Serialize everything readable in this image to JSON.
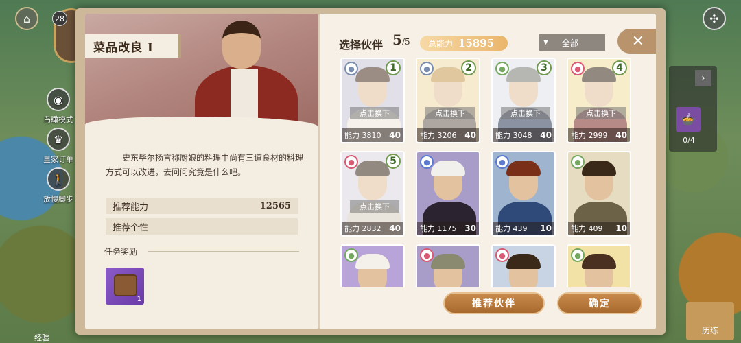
{
  "hud": {
    "level": "28",
    "buttons": [
      {
        "label": "鸟瞰模式"
      },
      {
        "label": "皇家订单"
      },
      {
        "label": "放慢脚步"
      }
    ],
    "exp_label": "经验",
    "side_count": "0/4",
    "bottom_label": "历练"
  },
  "quest": {
    "title": "菜品改良 I",
    "description": "史东毕尔扬言称厨娘的料理中尚有三道食材的料理方式可以改进，去问问究竟是什么吧。",
    "rec_power_label": "推荐能力",
    "rec_power_value": "12565",
    "rec_trait_label": "推荐个性",
    "reward_title": "任务奖励",
    "reward_qty": "1"
  },
  "partners": {
    "title": "选择伙伴",
    "selected": "5",
    "max": "/5",
    "total_label": "总能力",
    "total_value": "15895",
    "filter_label": "全部",
    "swap_label": "点击换下",
    "cards": [
      {
        "slot": "1",
        "power": "能力 3810",
        "level": "40",
        "selected": true,
        "bg": "#c8c6d8",
        "hair": "#4a3020",
        "body": "#efe6da",
        "badge": "#7a8fb0"
      },
      {
        "slot": "2",
        "power": "能力 3206",
        "level": "40",
        "selected": true,
        "bg": "#eed9a8",
        "hair": "#c79a4e",
        "body": "#6a5e54",
        "badge": "#7a8fb0"
      },
      {
        "slot": "3",
        "power": "能力 3048",
        "level": "40",
        "selected": true,
        "bg": "#dfe2e8",
        "hair": "#7a7a76",
        "body": "#2c3a55",
        "badge": "#74a860"
      },
      {
        "slot": "4",
        "power": "能力 2999",
        "level": "40",
        "selected": true,
        "bg": "#f0dfa0",
        "hair": "#3a2818",
        "body": "#7a2a26",
        "badge": "#d85a74"
      },
      {
        "slot": "5",
        "power": "能力 2832",
        "level": "40",
        "selected": true,
        "bg": "#dcd8e0",
        "hair": "#3a2818",
        "body": "#d9cfc0",
        "badge": "#d85a74"
      },
      {
        "slot": "",
        "power": "能力 1175",
        "level": "30",
        "selected": false,
        "bg": "#a89cc8",
        "hair": "#f2f0ec",
        "body": "#2b2430",
        "badge": "#5b7ad0"
      },
      {
        "slot": "",
        "power": "能力 439",
        "level": "10",
        "selected": false,
        "bg": "#9fb4cf",
        "hair": "#7a2f18",
        "body": "#2f4a78",
        "badge": "#5b7ad0"
      },
      {
        "slot": "",
        "power": "能力 409",
        "level": "10",
        "selected": false,
        "bg": "#e6dcc2",
        "hair": "#3a2818",
        "body": "#6b6248",
        "badge": "#74a860"
      },
      {
        "slot": "",
        "power": "",
        "level": "",
        "selected": false,
        "bg": "#b8a4d8",
        "hair": "#f4f0ea",
        "body": "#5a4a3d",
        "badge": "#74a860"
      },
      {
        "slot": "",
        "power": "",
        "level": "",
        "selected": false,
        "bg": "#a89cc8",
        "hair": "#8a8a70",
        "body": "#5a4a3d",
        "badge": "#d85a74"
      },
      {
        "slot": "",
        "power": "",
        "level": "",
        "selected": false,
        "bg": "#c8d4e4",
        "hair": "#3a2818",
        "body": "#5a4a3d",
        "badge": "#d85a74"
      },
      {
        "slot": "",
        "power": "",
        "level": "",
        "selected": false,
        "bg": "#f2e2a6",
        "hair": "#4a3020",
        "body": "#5a4a3d",
        "badge": "#74a860"
      }
    ],
    "recommend_label": "推荐伙伴",
    "confirm_label": "确定"
  }
}
